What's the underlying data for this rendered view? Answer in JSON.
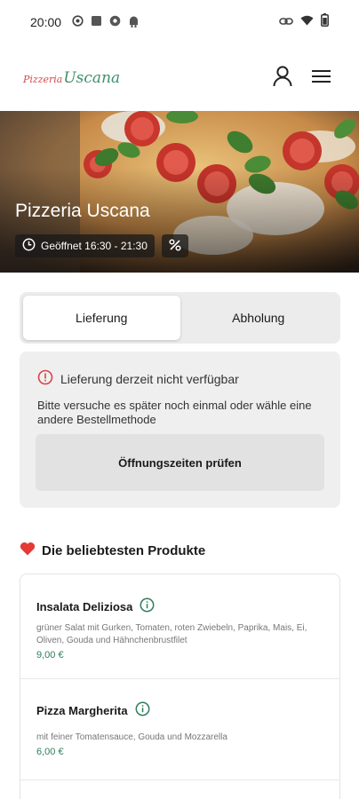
{
  "status_bar": {
    "time": "20:00",
    "icons_left": [
      "whatsapp-icon",
      "app-square-icon",
      "chrome-icon",
      "android-icon"
    ],
    "icons_right": [
      "link-icon",
      "wifi-icon",
      "battery-icon"
    ]
  },
  "header": {
    "logo_part1": "Pizzeria",
    "logo_part2": "Uscana",
    "icons": [
      "user-icon",
      "menu-icon"
    ]
  },
  "hero": {
    "title": "Pizzeria Uscana",
    "hours": "Geöffnet 16:30 - 21:30",
    "hours_icon": "clock-icon",
    "badge_icon": "percent-icon"
  },
  "order_mode": {
    "options": [
      "Lieferung",
      "Abholung"
    ],
    "selected": "Lieferung"
  },
  "delivery_notice": {
    "icon": "alert-circle-icon",
    "headline": "Lieferung derzeit nicht verfügbar",
    "message": "Bitte versuche es später noch einmal oder wähle eine andere Bestellmethode",
    "button_label": "Öffnungszeiten prüfen"
  },
  "popular": {
    "heading": "Die beliebtesten Produkte",
    "heading_icon": "heart-icon",
    "products": [
      {
        "name": "Insalata Deliziosa",
        "description": "grüner Salat mit Gurken, Tomaten, roten Zwiebeln, Paprika, Mais, Ei, Oliven, Gouda und Hähnchenbrustfilet",
        "price": "9,00 €"
      },
      {
        "name": "Pizza Margherita",
        "description": "mit feiner Tomatensauce, Gouda und Mozzarella",
        "price": "6,00 €"
      }
    ]
  },
  "colors": {
    "accent_green": "#2e7d5b",
    "alert_red": "#d9434a",
    "heart_red": "#e53935"
  }
}
